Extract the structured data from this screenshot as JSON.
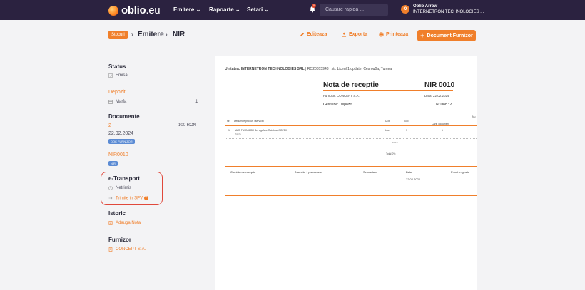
{
  "nav": {
    "logo_text": "oblio",
    "logo_suffix": ".eu",
    "menu": [
      "Emitere",
      "Rapoarte",
      "Setari"
    ],
    "notif_count": "0",
    "search_placeholder": "Cautare rapida ...",
    "user_name": "Oblio Arrow",
    "user_company": "INTERNETRON TECHNOLOGIES ...",
    "user_initial": "O"
  },
  "header": {
    "badge": "Stocuri",
    "crumb1": "Emitere",
    "crumb2": "NIR",
    "actions": {
      "edit": "Editeaza",
      "export": "Exporta",
      "print": "Printeaza"
    },
    "primary": "Document Furnizor"
  },
  "sidebar": {
    "status_title": "Status",
    "status_value": "Emisa",
    "depozit_title": "Depozit",
    "depozit_item": "Marfa",
    "depozit_count": "1",
    "documente_title": "Documente",
    "doc_number": "2",
    "doc_amount": "100 RON",
    "doc_date": "22.02.2024",
    "doc_badge": "DOC FURNIZOR",
    "nir_title": "NIR0010",
    "nir_badge": "NIR",
    "etransport_title": "e-Transport",
    "etransport_status": "Netrimis",
    "etransport_send": "Trimite in SPV",
    "istoric_title": "Istoric",
    "istoric_add": "Adauga Nota",
    "furnizor_title": "Furnizor",
    "furnizor_name": "CONCEPT S.A."
  },
  "document": {
    "unit_line_bold": "Unitatea: INTERNETRON TECHNOLOGIES SRL",
    "unit_line_rest": " | RO20815948 | str. Liceul 1 update, Cesrou0a, Turcea",
    "title": "Nota de receptie",
    "nir": "NIR 0010",
    "furnizor_label": "Furnizor:",
    "furnizor_value": "CONCEPT S.A.",
    "data_label": "Data:",
    "data_value": "22.02.2024",
    "gestiune_label": "Gestiune:",
    "gestiune_value": "Depozit",
    "nrdoc_label": "Nr.Doc.:",
    "nrdoc_value": "2",
    "col_nr": "Nr.",
    "col_den": "Denumire produs / serviciu",
    "col_um": "U.M",
    "col_cod": "Cod",
    "col_nu": "Nu",
    "col_cant": "Cant. document",
    "row_nr": "1",
    "row_name": "AZE FURNIZOR Set agafare Rainbow'COFEX",
    "row_sub": "Marfa",
    "row_um": "buc",
    "row_cod": "1",
    "row_cant": "1",
    "sub_total": "Total 1",
    "total": "Total 0%",
    "sig_comisia": "Comisia de receptie",
    "sig_nume": "Numele + prenumele",
    "sig_semn": "Semnatura",
    "sig_data": "Data",
    "sig_primit": "Primit in gestiu",
    "sig_date_value": "22.02.2024"
  },
  "colors": {
    "accent": "#f07f2b",
    "nav_bg": "#2b2240",
    "badge_blue": "#5b8bd4",
    "highlight_border": "#e0483b"
  }
}
